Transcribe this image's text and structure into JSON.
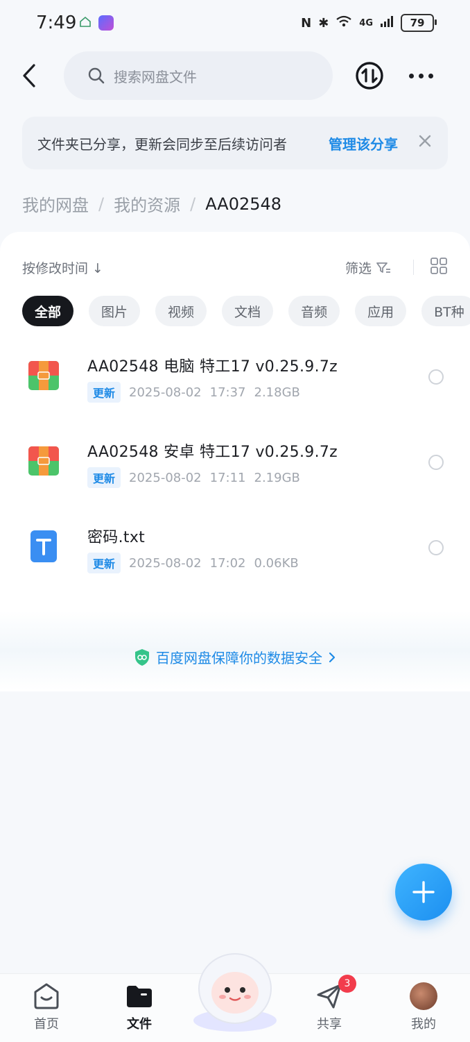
{
  "status_bar": {
    "time": "7:49",
    "network": "4G",
    "battery": "79"
  },
  "header": {
    "search_placeholder": "搜索网盘文件"
  },
  "share_banner": {
    "text": "文件夹已分享，更新会同步至后续访问者",
    "link": "管理该分享"
  },
  "breadcrumb": {
    "items": [
      "我的网盘",
      "我的资源"
    ],
    "current": "AA02548"
  },
  "toolbar": {
    "sort_label": "按修改时间 ↓",
    "filter_label": "筛选"
  },
  "chips": [
    "全部",
    "图片",
    "视频",
    "文档",
    "音频",
    "应用",
    "BT种"
  ],
  "files": [
    {
      "name": "AA02548 电脑 特工17 v0.25.9.7z",
      "tag": "更新",
      "date": "2025-08-02",
      "time": "17:37",
      "size": "2.18GB",
      "icon": "archive-icon"
    },
    {
      "name": "AA02548 安卓 特工17 v0.25.9.7z",
      "tag": "更新",
      "date": "2025-08-02",
      "time": "17:11",
      "size": "2.19GB",
      "icon": "archive-icon"
    },
    {
      "name": "密码.txt",
      "tag": "更新",
      "date": "2025-08-02",
      "time": "17:02",
      "size": "0.06KB",
      "icon": "text-file-icon"
    }
  ],
  "safety_notice": "百度网盘保障你的数据安全",
  "nav": {
    "home": "首页",
    "files": "文件",
    "share": "共享",
    "mine": "我的",
    "share_badge": "3"
  },
  "colors": {
    "accent": "#1e8ae6",
    "badge": "#f23c4c"
  }
}
